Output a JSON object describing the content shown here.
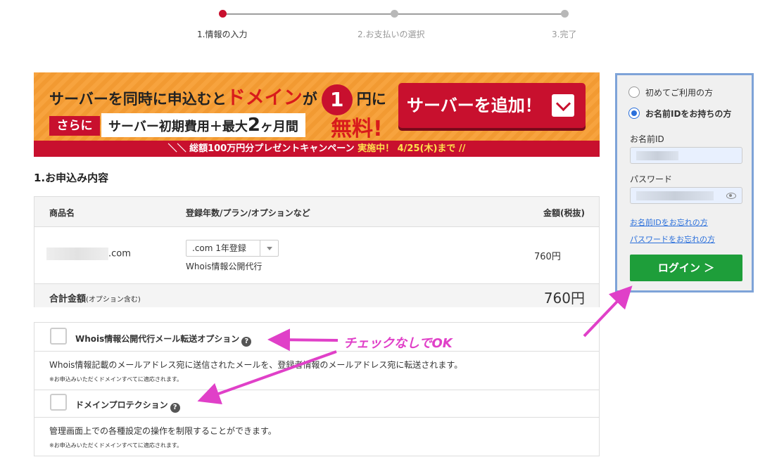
{
  "steps": [
    {
      "label": "1.情報の入力",
      "active": true
    },
    {
      "label": "2.お支払いの選択",
      "active": false
    },
    {
      "label": "3.完了",
      "active": false
    }
  ],
  "banner": {
    "line1_a": "サーバーを同時に申込むと",
    "line1_b": "ドメイン",
    "line1_c": "が",
    "line1_num": "1",
    "line1_d": "円に",
    "sarani": "さらに",
    "line2_a": "サーバー初期費用＋最大",
    "line2_num": "2",
    "line2_b": "ヶ月間",
    "free": "無料!",
    "button_label": "サーバーを追加！",
    "campaign_a": "＼＼ 総額100万円分プレゼントキャンペーン",
    "campaign_b": "実施中！ 4/25(木)まで //"
  },
  "section_title": "1.お申込み内容",
  "order": {
    "col_product": "商品名",
    "col_plan": "登録年数/プラン/オプションなど",
    "col_price": "金額(税抜)",
    "domain_suffix": ".com",
    "plan_selected": ".com 1年登録",
    "plan_note": "Whois情報公開代行",
    "price": "760円",
    "total_label": "合計金額",
    "total_note": "(オプション含む)",
    "total_price": "760円"
  },
  "options": [
    {
      "title": "Whois情報公開代行メール転送オプション",
      "desc": "Whois情報記載のメールアドレス宛に送信されたメールを、登録者情報のメールアドレス宛に転送されます。",
      "note": "※お申込みいただくドメインすべてに適応されます。"
    },
    {
      "title": "ドメインプロテクション",
      "desc": "管理画面上での各種設定の操作を制限することができます。",
      "note": "※お申込みいただくドメインすべてに適応されます。"
    }
  ],
  "annotation": "チェックなしでOK",
  "login": {
    "radio_first": "初めてご利用の方",
    "radio_existing": "お名前IDをお持ちの方",
    "id_label": "お名前ID",
    "password_label": "パスワード",
    "forgot_id": "お名前IDをお忘れの方",
    "forgot_password": "パスワードをお忘れの方",
    "login_button": "ログイン ＞"
  },
  "colors": {
    "accent": "#c8102e",
    "login_green": "#1e9e3a",
    "annotation": "#e040c8",
    "panel_border": "#7ea3d8"
  }
}
